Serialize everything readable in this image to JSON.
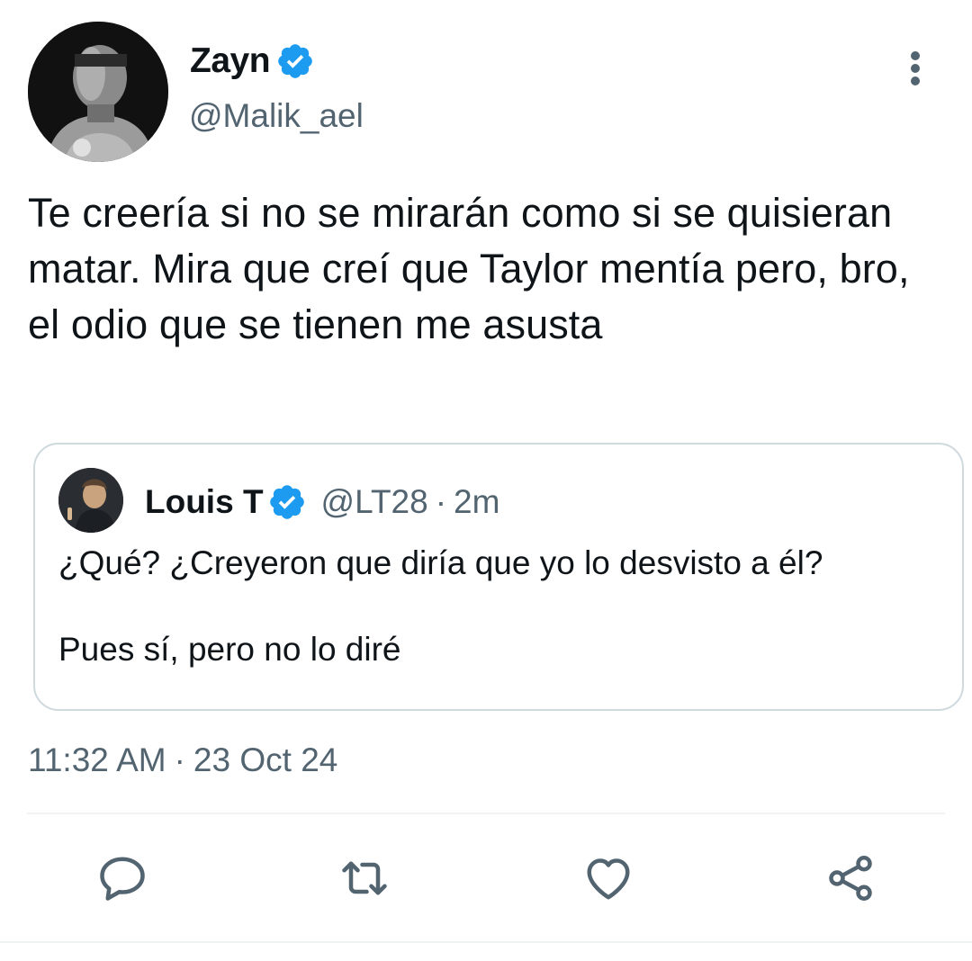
{
  "author": {
    "display_name": "Zayn",
    "handle": "@Malik_ael",
    "verified": true,
    "avatar_icon": "avatar-photo-icon"
  },
  "tweet": {
    "text": "Te creería si no se mirarán como si se quisieran matar. Mira que creí que Taylor mentía pero, bro, el odio que se tienen me asusta",
    "time": "11:32 AM",
    "separator": "·",
    "date": "23 Oct 24"
  },
  "quoted": {
    "display_name": "Louis T",
    "handle": "@LT28",
    "separator": "·",
    "time": "2m",
    "verified": true,
    "paragraphs": [
      "¿Qué? ¿Creyeron que diría que yo lo desvisto a él?",
      "Pues sí, pero no lo diré"
    ]
  },
  "actions": [
    {
      "name": "reply",
      "icon": "comment-icon"
    },
    {
      "name": "retweet",
      "icon": "retweet-icon"
    },
    {
      "name": "like",
      "icon": "heart-icon"
    },
    {
      "name": "share",
      "icon": "share-icon"
    }
  ],
  "colors": {
    "text_primary": "#0f1419",
    "text_secondary": "#536471",
    "verified_blue": "#1d9bf0",
    "border": "#cfd9de",
    "divider": "#eff3f4"
  }
}
